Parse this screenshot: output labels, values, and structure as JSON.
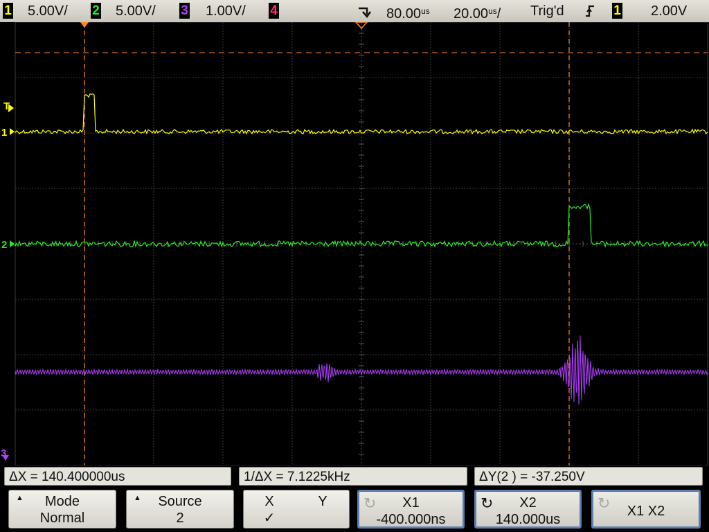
{
  "colors": {
    "ch1": "#ffff00",
    "ch2": "#22ee22",
    "ch3": "#b040ff",
    "ch4": "#ff3070",
    "cursor": "#ff8a1e",
    "grid": "#3c3c3c",
    "softkey_active_border": "#5a7fb0"
  },
  "status_bar": {
    "channels": [
      {
        "number": "1",
        "scale": "5.00V/"
      },
      {
        "number": "2",
        "scale": "5.00V/"
      },
      {
        "number": "3",
        "scale": "1.00V/"
      },
      {
        "number": "4",
        "scale": ""
      }
    ],
    "trigger_position_icon": "delay-marker-icon",
    "delay": "80.00",
    "delay_unit": "us",
    "timebase": "20.00",
    "timebase_unit": "us",
    "timebase_suffix": "/",
    "trigger_status": "Trig'd",
    "trigger_slope_icon": "rising-edge-icon",
    "trigger_source": "1",
    "trigger_level": "2.00V"
  },
  "markers": {
    "trigger_level": "T",
    "ch1": "1",
    "ch2": "2",
    "ch3": "3"
  },
  "readouts": {
    "delta_x": "ΔX = 140.400000us",
    "inverse_delta_x": "1/ΔX = 7.1225kHz",
    "delta_y": "ΔY(2 ) = -37.250V"
  },
  "softkeys": {
    "mode": {
      "title": "Mode",
      "value": "Normal"
    },
    "source": {
      "title": "Source",
      "value": "2"
    },
    "xy": {
      "x_label": "X",
      "y_label": "Y",
      "check": "✓"
    },
    "x1": {
      "title": "X1",
      "value": "-400.000ns"
    },
    "x2": {
      "title": "X2",
      "value": "140.000us"
    },
    "x1x2": {
      "title": "X1 X2"
    }
  }
}
